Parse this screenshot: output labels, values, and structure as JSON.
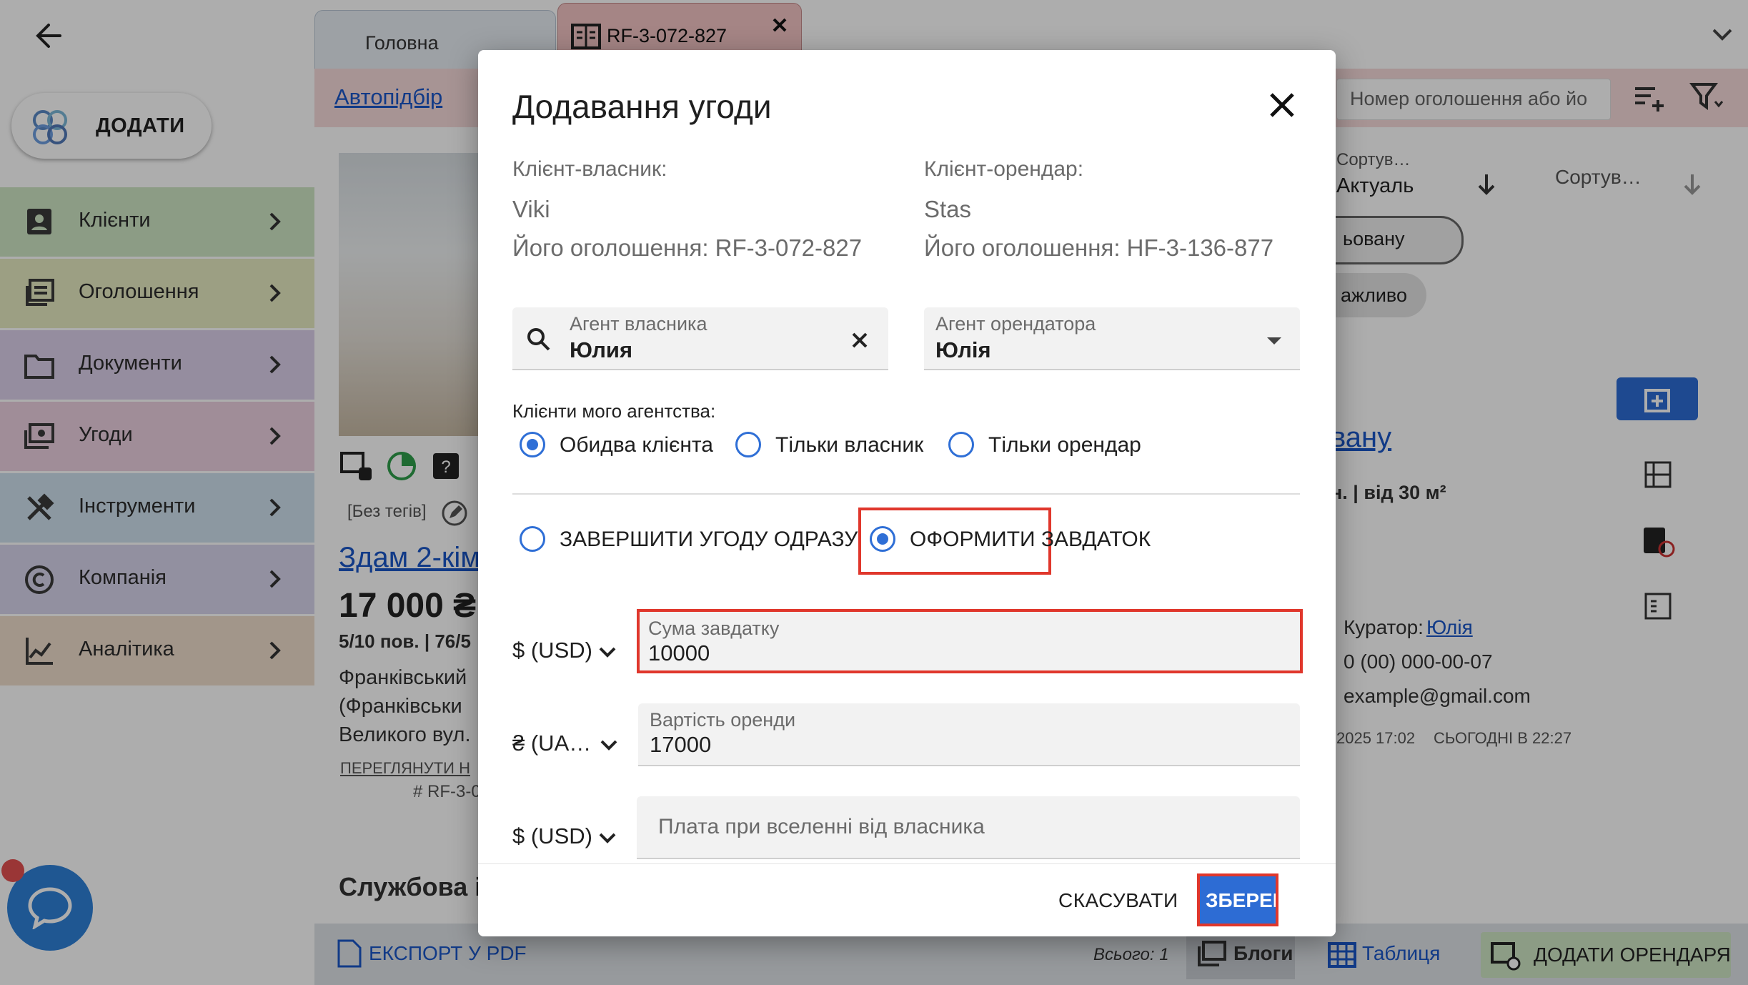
{
  "sidebar": {
    "add_label": "ДОДАТИ",
    "items": [
      {
        "label": "Клієнти",
        "color": "#cfe6c4",
        "icon": "contacts-icon"
      },
      {
        "label": "Оголошення",
        "color": "#e6ebc2",
        "icon": "listings-icon"
      },
      {
        "label": "Документи",
        "color": "#dcd0ea",
        "icon": "folder-icon"
      },
      {
        "label": "Угоди",
        "color": "#ecd0e0",
        "icon": "deal-icon"
      },
      {
        "label": "Інструменти",
        "color": "#cfe1ee",
        "icon": "tools-icon"
      },
      {
        "label": "Компанія",
        "color": "#d7d5ec",
        "icon": "copyright-icon"
      },
      {
        "label": "Аналітика",
        "color": "#efddcc",
        "icon": "analytics-icon"
      }
    ]
  },
  "tabs": [
    {
      "label": "Головна"
    },
    {
      "label": "RF-3-072-827"
    }
  ],
  "subbar": {
    "autopick": "Автопідбір",
    "search_placeholder": "Номер оголошення або йо"
  },
  "background": {
    "tags": "[Без тегів]",
    "listing_title": "Здам 2-кім",
    "price": "17 000 ₴",
    "floor_info": "5/10 пов. | 76/5",
    "address_1": "Франківський",
    "address_2": "(Франківськи",
    "address_3": "Великого вул.",
    "view_link": "ПЕРЕГЛЯНУТИ Н",
    "listing_id": "# RF-3-0",
    "service_info": "Службова ін",
    "sort_label": "Сортув…",
    "sort_value": "Актуаль",
    "sort2": "Сортув…",
    "chip1": "ьовану",
    "chip2": "ажливо",
    "right_link": "вану",
    "right_area": "н. | від 30 м²",
    "curator_label": "Куратор:",
    "curator_name": "Юлія",
    "phone": "0 (00) 000-00-07",
    "email": "example@gmail.com",
    "date_left": "2025 17:02",
    "date_right": "СЬОГОДНІ В 22:27",
    "export": "ЕКСПОРТ У PDF",
    "total": "Всього: 1",
    "blogs": "Блоги",
    "table": "Таблиця",
    "add_tenant": "ДОДАТИ ОРЕНДАРЯ"
  },
  "modal": {
    "title": "Додавання угоди",
    "owner_client_label": "Клієнт-власник:",
    "owner_client_name": "Viki",
    "owner_listing": "Його оголошення: RF-3-072-827",
    "tenant_client_label": "Клієнт-орендар:",
    "tenant_client_name": "Stas",
    "tenant_listing": "Його оголошення: HF-3-136-877",
    "owner_agent_label": "Агент власника",
    "owner_agent_value": "Юлия",
    "tenant_agent_label": "Агент орендатора",
    "tenant_agent_value": "Юлія",
    "agency_clients_label": "Клієнти мого агентства:",
    "agency_options": [
      "Обидва клієнта",
      "Тільки власник",
      "Тільки орендар"
    ],
    "agency_selected": 0,
    "mode_options": [
      "ЗАВЕРШИТИ УГОДУ ОДРАЗУ",
      "ОФОРМИТИ ЗАВДАТОК"
    ],
    "mode_selected": 1,
    "deposit_currency": "$ (USD)",
    "deposit_label": "Сума завдатку",
    "deposit_value": "10000",
    "rent_currency": "₴ (UA…",
    "rent_label": "Вартість оренди",
    "rent_value": "17000",
    "fee_currency": "$ (USD)",
    "fee_placeholder": "Плата при вселенні від власника",
    "cancel_label": "СКАСУВАТИ",
    "save_label": "ЗБЕРЕГТИ"
  }
}
